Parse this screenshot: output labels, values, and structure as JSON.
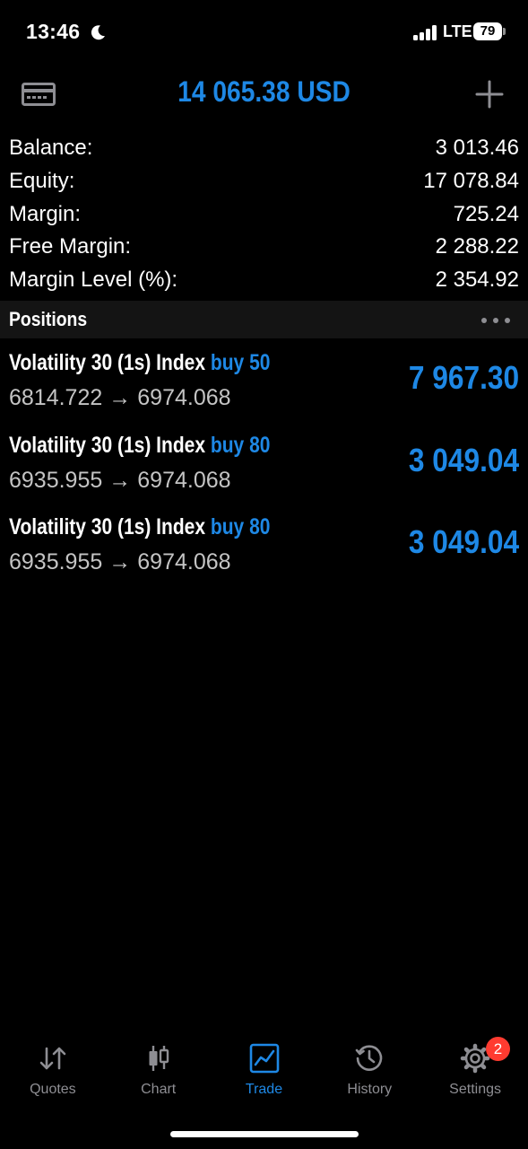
{
  "status_bar": {
    "time": "13:46",
    "network": "LTE",
    "battery": "79",
    "icons": [
      "moon-icon",
      "signal-icon",
      "battery-icon"
    ]
  },
  "header": {
    "title": "14 065.38 USD",
    "left_icon": "card-icon",
    "right_icon": "plus-icon"
  },
  "summary": [
    {
      "label": "Balance:",
      "value": "3 013.46"
    },
    {
      "label": "Equity:",
      "value": "17 078.84"
    },
    {
      "label": "Margin:",
      "value": "725.24"
    },
    {
      "label": "Free Margin:",
      "value": "2 288.22"
    },
    {
      "label": "Margin Level (%):",
      "value": "2 354.92"
    }
  ],
  "positions_header": {
    "title": "Positions",
    "menu_icon": "more-icon"
  },
  "positions": [
    {
      "symbol": "Volatility 30 (1s) Index",
      "side": "buy",
      "volume": "50",
      "open_price": "6814.722",
      "arrow": "→",
      "current_price": "6974.068",
      "profit": "7 967.30"
    },
    {
      "symbol": "Volatility 30 (1s) Index",
      "side": "buy",
      "volume": "80",
      "open_price": "6935.955",
      "arrow": "→",
      "current_price": "6974.068",
      "profit": "3 049.04"
    },
    {
      "symbol": "Volatility 30 (1s) Index",
      "side": "buy",
      "volume": "80",
      "open_price": "6935.955",
      "arrow": "→",
      "current_price": "6974.068",
      "profit": "3 049.04"
    }
  ],
  "tabs": [
    {
      "label": "Quotes",
      "icon": "quotes-icon",
      "active": false
    },
    {
      "label": "Chart",
      "icon": "chart-icon",
      "active": false
    },
    {
      "label": "Trade",
      "icon": "trade-icon",
      "active": true
    },
    {
      "label": "History",
      "icon": "history-icon",
      "active": false
    },
    {
      "label": "Settings",
      "icon": "settings-icon",
      "active": false,
      "badge": "2"
    }
  ],
  "colors": {
    "background": "#000000",
    "accent": "#1e88e5",
    "secondary_text": "#c4c4c4",
    "inactive_tab": "#8e8e93",
    "badge": "#ff3b30"
  }
}
